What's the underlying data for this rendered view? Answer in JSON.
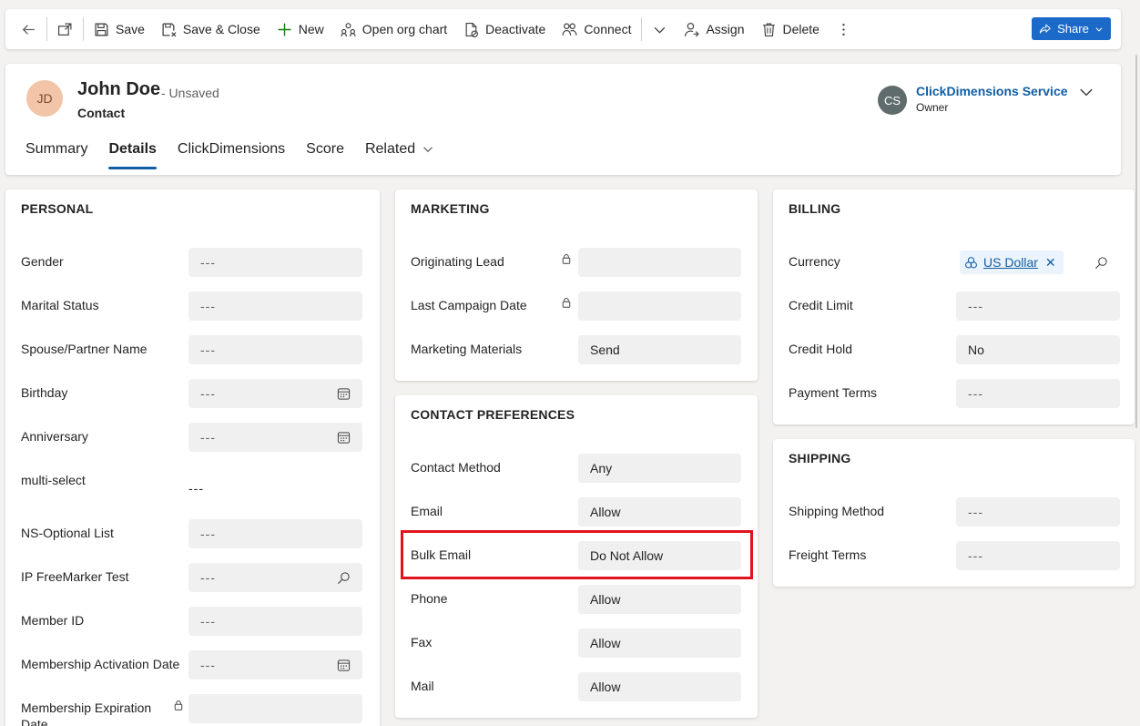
{
  "commandbar": {
    "save": "Save",
    "save_close": "Save & Close",
    "new": "New",
    "org_chart": "Open org chart",
    "deactivate": "Deactivate",
    "connect": "Connect",
    "assign": "Assign",
    "delete": "Delete",
    "share": "Share"
  },
  "record": {
    "initials": "JD",
    "name": "John Doe",
    "unsaved": "- Unsaved",
    "type": "Contact",
    "owner_initials": "CS",
    "owner_name": "ClickDimensions Service",
    "owner_label": "Owner"
  },
  "tabs": [
    "Summary",
    "Details",
    "ClickDimensions",
    "Score",
    "Related"
  ],
  "personal": {
    "title": "PERSONAL",
    "fields": [
      {
        "label": "Gender",
        "value": "---"
      },
      {
        "label": "Marital Status",
        "value": "---"
      },
      {
        "label": "Spouse/Partner Name",
        "value": "---"
      },
      {
        "label": "Birthday",
        "value": "---"
      },
      {
        "label": "Anniversary",
        "value": "---"
      },
      {
        "label": "multi-select",
        "value": "---"
      },
      {
        "label": "NS-Optional List",
        "value": "---"
      },
      {
        "label": "IP FreeMarker Test",
        "value": "---"
      },
      {
        "label": "Member ID",
        "value": "---"
      },
      {
        "label": "Membership Activation Date",
        "value": "---"
      },
      {
        "label": "Membership Expiration Date",
        "value": ""
      }
    ]
  },
  "marketing": {
    "title": "MARKETING",
    "fields": [
      {
        "label": "Originating Lead",
        "value": ""
      },
      {
        "label": "Last Campaign Date",
        "value": ""
      },
      {
        "label": "Marketing Materials",
        "value": "Send"
      }
    ]
  },
  "contact_prefs": {
    "title": "CONTACT PREFERENCES",
    "fields": [
      {
        "label": "Contact Method",
        "value": "Any"
      },
      {
        "label": "Email",
        "value": "Allow"
      },
      {
        "label": "Bulk Email",
        "value": "Do Not Allow"
      },
      {
        "label": "Phone",
        "value": "Allow"
      },
      {
        "label": "Fax",
        "value": "Allow"
      },
      {
        "label": "Mail",
        "value": "Allow"
      }
    ]
  },
  "billing": {
    "title": "BILLING",
    "fields": [
      {
        "label": "Currency",
        "value": "US Dollar"
      },
      {
        "label": "Credit Limit",
        "value": "---"
      },
      {
        "label": "Credit Hold",
        "value": "No"
      },
      {
        "label": "Payment Terms",
        "value": "---"
      }
    ]
  },
  "shipping": {
    "title": "SHIPPING",
    "fields": [
      {
        "label": "Shipping Method",
        "value": "---"
      },
      {
        "label": "Freight Terms",
        "value": "---"
      }
    ]
  },
  "colors": {
    "accent": "#115ea3",
    "share": "#1b6ac9",
    "highlight": "#e0121d"
  }
}
